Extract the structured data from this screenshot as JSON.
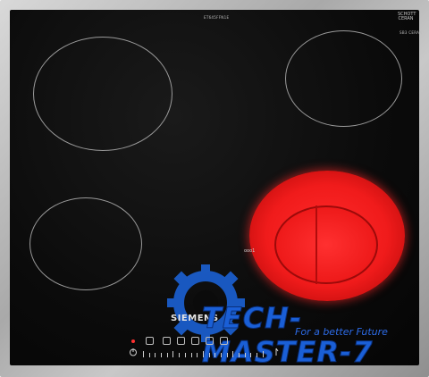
{
  "hob": {
    "model_code": "ET645FFN1E",
    "schott_brand": "SCHOTT CERAN",
    "glass_code": "SB3 CERAN",
    "brand": "SIEMENS",
    "zone_label": "ooo1"
  },
  "watermark": {
    "title": "TECH-MASTER-7",
    "subtitle": "For a better Future"
  },
  "colors": {
    "glass": "#0b0b0b",
    "frame": "#b5b5b5",
    "hot_zone": "#ff2b2b",
    "watermark": "#1a5fd6"
  },
  "icons": [
    "power-icon",
    "lock-icon",
    "timer-icon",
    "booster-icon",
    "childlock-icon",
    "zone-select-icon"
  ]
}
